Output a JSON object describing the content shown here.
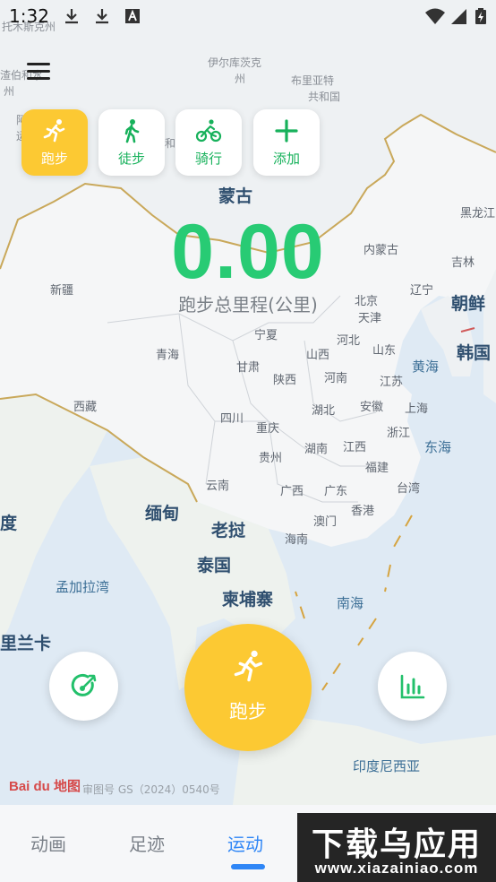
{
  "status_bar": {
    "time": "1:32",
    "icons": [
      "download-icon",
      "download-icon",
      "font-icon",
      "wifi-icon",
      "signal-icon",
      "battery-charging-icon"
    ]
  },
  "menu": {
    "icon": "hamburger-menu-icon"
  },
  "modes": [
    {
      "label": "跑步",
      "icon": "running-icon",
      "active": true
    },
    {
      "label": "徒步",
      "icon": "walking-icon",
      "active": false
    },
    {
      "label": "骑行",
      "icon": "cycling-icon",
      "active": false
    },
    {
      "label": "添加",
      "icon": "plus-icon",
      "active": false
    }
  ],
  "stats": {
    "distance": "0.00",
    "distance_label": "跑步总里程(公里)"
  },
  "map": {
    "labels": {
      "tuokemu": "托木斯克州",
      "yierku": "伊尔库茨克",
      "yierku2": "州",
      "buliya": "布里亚特",
      "buliya2": "共和国",
      "zhibai": "渣伯和水",
      "zhibai2": "州",
      "a": "阿",
      "yun": "运",
      "he": "和",
      "menggu": "蒙古",
      "heilongjiang": "黑龙江",
      "jilin": "吉林",
      "neimenggu": "内蒙古",
      "liaoning": "辽宁",
      "xinjiang": "新疆",
      "beijing": "北京",
      "tianjin": "天津",
      "hebei": "河北",
      "shandong": "山东",
      "chaoxian": "朝鲜",
      "hanguo": "韩国",
      "qinghai": "青海",
      "ningxia": "宁夏",
      "gansu": "甘肃",
      "shanxi": "山西",
      "shaanxi": "陕西",
      "henan": "河南",
      "jiangsu": "江苏",
      "huanghai": "黄海",
      "xizang": "西藏",
      "sichuan": "四川",
      "hubei": "湖北",
      "anhui": "安徽",
      "shanghai": "上海",
      "chongqing": "重庆",
      "zhejiang": "浙江",
      "donghai": "东海",
      "guizhou": "贵州",
      "hunan": "湖南",
      "jiangxi": "江西",
      "fujian": "福建",
      "yunnan": "云南",
      "guangxi": "广西",
      "guangdong": "广东",
      "taiwan": "台湾",
      "aomen": "澳门",
      "xianggang": "香港",
      "miandian": "缅甸",
      "laowo": "老挝",
      "du": "度",
      "hainan": "海南",
      "taiguo": "泰国",
      "mengjiala": "孟加拉湾",
      "jianpuzhai": "柬埔寨",
      "nanhai": "南海",
      "lilanka": "里兰卡",
      "yinni": "印度尼西亚"
    }
  },
  "buttons": {
    "target_icon": "target-goal-icon",
    "start_label": "跑步",
    "start_icon": "running-icon",
    "stats_icon": "bar-chart-icon"
  },
  "map_footer": {
    "logo": "Bai du 地图",
    "copyright": "审图号 GS（2024）0540号"
  },
  "tabs": [
    {
      "label": "动画",
      "active": false
    },
    {
      "label": "足迹",
      "active": false
    },
    {
      "label": "运动",
      "active": true
    }
  ],
  "watermark": {
    "main": "下载乌应用",
    "sub": "www.xiazainiao.com"
  },
  "colors": {
    "accent_yellow": "#fcc933",
    "accent_green": "#28cb74",
    "tab_active": "#2f86f6"
  }
}
